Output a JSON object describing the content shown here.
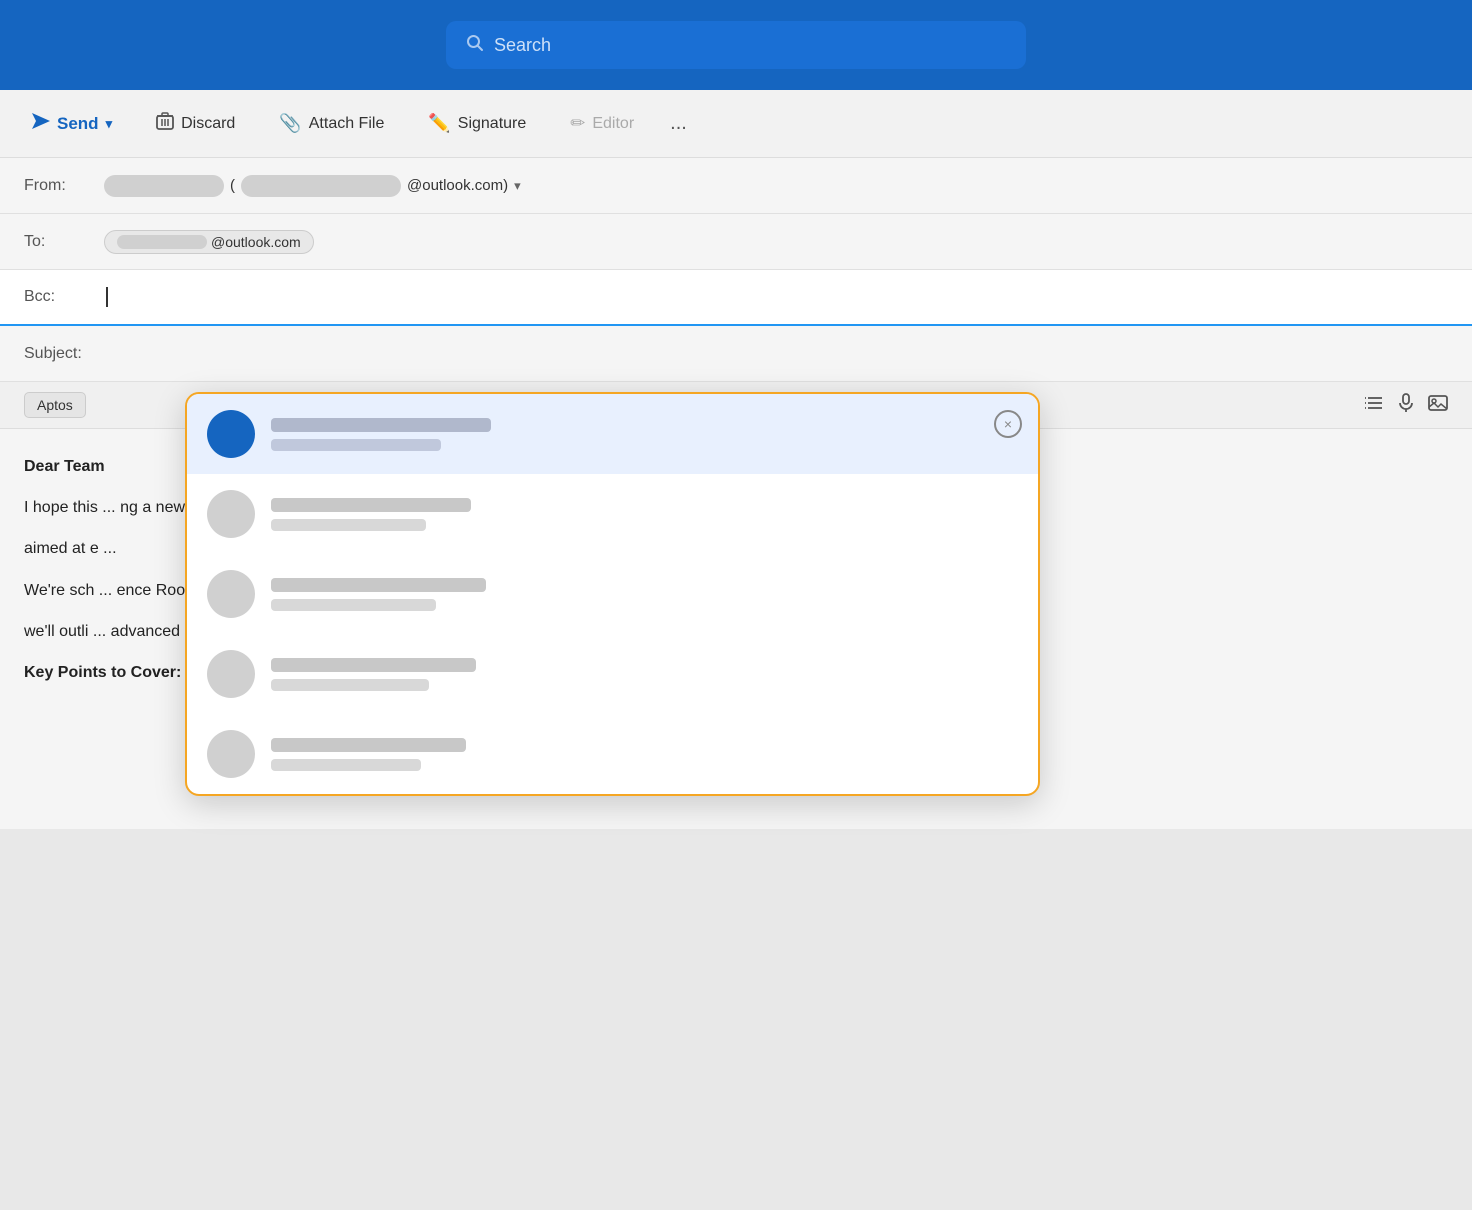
{
  "topbar": {
    "search_placeholder": "Search"
  },
  "toolbar": {
    "send_label": "Send",
    "discard_label": "Discard",
    "attach_file_label": "Attach File",
    "signature_label": "Signature",
    "editor_label": "Editor",
    "more_label": "..."
  },
  "email": {
    "from_label": "From:",
    "to_label": "To:",
    "bcc_label": "Bcc:",
    "subject_label": "Subject:",
    "to_address_suffix": "@outlook.com",
    "from_address_suffix": "@outlook.com)",
    "font_name": "Aptos"
  },
  "body": {
    "line1": "Dear Team",
    "line2_prefix": "I hope this",
    "line2_suffix": "ng a new Emai",
    "line3_prefix": "aimed at e",
    "line4_prefix": "We're sch",
    "line4_suffix": "ence Room A.",
    "line5_prefix": "we'll outli",
    "line5_suffix": "advanced inb",
    "line6": "Key Points to Cover:"
  },
  "autocomplete": {
    "close_label": "×",
    "contacts": [
      {
        "id": 1,
        "name_width": 220,
        "email_width": 170,
        "active": true
      },
      {
        "id": 2,
        "name_width": 200,
        "email_width": 155,
        "active": false
      },
      {
        "id": 3,
        "name_width": 215,
        "email_width": 165,
        "active": false
      },
      {
        "id": 4,
        "name_width": 205,
        "email_width": 158,
        "active": false
      },
      {
        "id": 5,
        "name_width": 195,
        "email_width": 150,
        "active": false
      }
    ]
  }
}
